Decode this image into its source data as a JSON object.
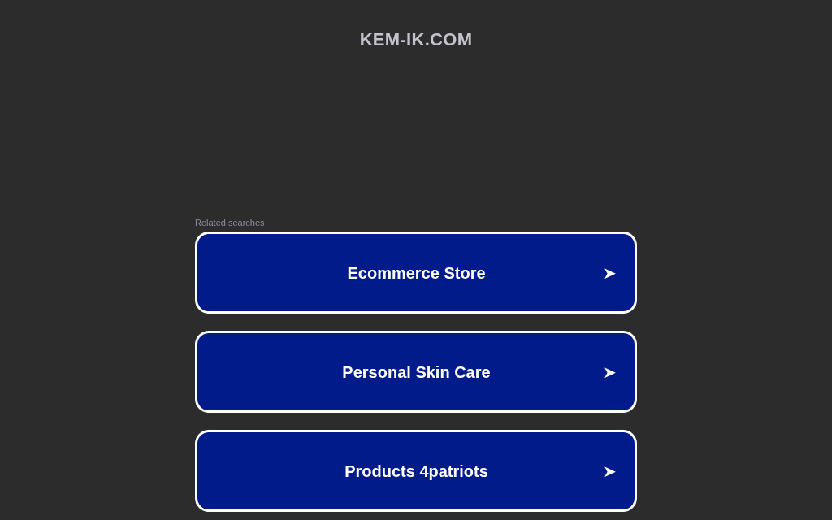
{
  "header": {
    "title": "KEM-IK.COM"
  },
  "related": {
    "heading": "Related searches",
    "links": [
      {
        "label": "Ecommerce Store",
        "arrow": "➤"
      },
      {
        "label": "Personal Skin Care",
        "arrow": "➤"
      },
      {
        "label": "Products 4patriots",
        "arrow": "➤"
      }
    ]
  }
}
